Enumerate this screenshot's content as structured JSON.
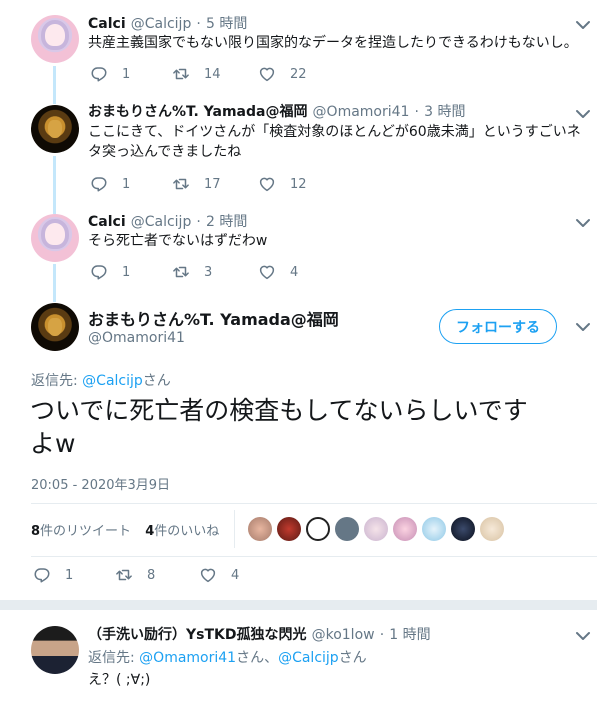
{
  "tweets": [
    {
      "name": "Calci",
      "handle": "@Calcijp",
      "dot": "·",
      "time": "5 時間",
      "text": "共産主義国家でもない限り国家的なデータを捏造したりできるわけもないし。",
      "replies": "1",
      "retweets": "14",
      "likes": "22"
    },
    {
      "name": "おまもりさん%T. Yamada@福岡",
      "handle": "@Omamori41",
      "dot": "·",
      "time": "3 時間",
      "text_line1": "ここにきて、ドイツさんが「検査対象のほとんどが60歳未満」というすごいネ",
      "text_line2": "タ突っ込んできましたね",
      "replies": "1",
      "retweets": "17",
      "likes": "12"
    },
    {
      "name": "Calci",
      "handle": "@Calcijp",
      "dot": "·",
      "time": "2 時間",
      "text": "そら死亡者でないはずだわw",
      "replies": "1",
      "retweets": "3",
      "likes": "4"
    }
  ],
  "main": {
    "name": "おまもりさん%T. Yamada@福岡",
    "handle": "@Omamori41",
    "follow_label": "フォローする",
    "reply_prefix": "返信先: ",
    "reply_to": "@Calcijp",
    "reply_suffix": "さん",
    "text_line1": "ついでに死亡者の検査もしてないらしいです",
    "text_line2": "よw",
    "timestamp": "20:05 - 2020年3月9日",
    "retweet_count": "8",
    "retweet_label": "件のリツイート",
    "like_count": "4",
    "like_label": "件のいいね",
    "replies": "1",
    "retweets": "8",
    "likes": "4"
  },
  "reply": {
    "name": "（手洗い励行）YsTKD孤独な閃光",
    "handle": "@ko1low",
    "dot": "·",
    "time": "1 時間",
    "reply_prefix": "返信先: ",
    "reply_to1": "@Omamori41",
    "reply_mid": "さん、",
    "reply_to2": "@Calcijp",
    "reply_suffix": "さん",
    "text": "え？( ;∀;)"
  },
  "colors": {
    "accent": "#1da1f2",
    "muted": "#657786",
    "thread_line": "#c4e7fb"
  }
}
